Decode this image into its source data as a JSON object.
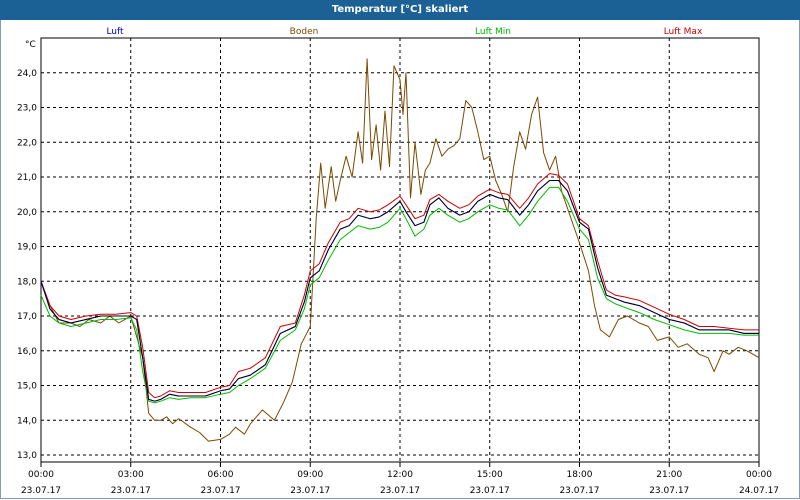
{
  "window": {
    "title": "Temperatur [°C] skaliert"
  },
  "chart_data": {
    "type": "line",
    "title": "Temperatur [°C] skaliert",
    "ylabel": "°C",
    "xlabel": "",
    "ylim": [
      12.8,
      25.0
    ],
    "xlim": [
      0,
      24
    ],
    "grid": true,
    "legend_position": "top",
    "yticks": [
      "13,0",
      "14,0",
      "15,0",
      "16,0",
      "17,0",
      "18,0",
      "19,0",
      "20,0",
      "21,0",
      "22,0",
      "23,0",
      "24,0"
    ],
    "xticks": [
      {
        "time": "00:00",
        "date": "23.07.17"
      },
      {
        "time": "03:00",
        "date": "23.07.17"
      },
      {
        "time": "06:00",
        "date": "23.07.17"
      },
      {
        "time": "09:00",
        "date": "23.07.17"
      },
      {
        "time": "12:00",
        "date": "23.07.17"
      },
      {
        "time": "15:00",
        "date": "23.07.17"
      },
      {
        "time": "18:00",
        "date": "23.07.17"
      },
      {
        "time": "21:00",
        "date": "23.07.17"
      },
      {
        "time": "00:00",
        "date": "24.07.17"
      }
    ],
    "series": [
      {
        "name": "Luft",
        "color": "#0000cc",
        "points": [
          [
            0,
            18.0
          ],
          [
            0.3,
            17.2
          ],
          [
            0.6,
            16.9
          ],
          [
            1,
            16.8
          ],
          [
            1.5,
            16.9
          ],
          [
            2,
            17.0
          ],
          [
            2.5,
            17.0
          ],
          [
            3,
            17.0
          ],
          [
            3.2,
            16.9
          ],
          [
            3.4,
            15.8
          ],
          [
            3.6,
            14.6
          ],
          [
            3.8,
            14.55
          ],
          [
            4,
            14.6
          ],
          [
            4.3,
            14.75
          ],
          [
            4.6,
            14.7
          ],
          [
            5,
            14.7
          ],
          [
            5.5,
            14.7
          ],
          [
            6,
            14.85
          ],
          [
            6.3,
            14.9
          ],
          [
            6.6,
            15.2
          ],
          [
            7,
            15.3
          ],
          [
            7.5,
            15.6
          ],
          [
            8,
            16.5
          ],
          [
            8.5,
            16.7
          ],
          [
            8.8,
            17.4
          ],
          [
            9,
            18.1
          ],
          [
            9.3,
            18.3
          ],
          [
            9.6,
            18.9
          ],
          [
            10,
            19.5
          ],
          [
            10.3,
            19.6
          ],
          [
            10.6,
            19.9
          ],
          [
            11,
            19.8
          ],
          [
            11.3,
            19.85
          ],
          [
            11.6,
            20.0
          ],
          [
            12,
            20.3
          ],
          [
            12.2,
            20.0
          ],
          [
            12.5,
            19.6
          ],
          [
            12.8,
            19.7
          ],
          [
            13,
            20.2
          ],
          [
            13.3,
            20.4
          ],
          [
            13.6,
            20.1
          ],
          [
            14,
            19.9
          ],
          [
            14.3,
            20.0
          ],
          [
            14.6,
            20.3
          ],
          [
            15,
            20.5
          ],
          [
            15.3,
            20.4
          ],
          [
            15.6,
            20.35
          ],
          [
            16,
            19.9
          ],
          [
            16.3,
            20.2
          ],
          [
            16.6,
            20.6
          ],
          [
            17,
            20.9
          ],
          [
            17.3,
            20.9
          ],
          [
            17.6,
            20.6
          ],
          [
            18,
            19.7
          ],
          [
            18.3,
            19.5
          ],
          [
            18.6,
            18.4
          ],
          [
            18.9,
            17.6
          ],
          [
            19.2,
            17.5
          ],
          [
            19.5,
            17.4
          ],
          [
            20,
            17.3
          ],
          [
            20.5,
            17.1
          ],
          [
            21,
            16.9
          ],
          [
            21.5,
            16.8
          ],
          [
            22,
            16.6
          ],
          [
            22.5,
            16.6
          ],
          [
            23,
            16.6
          ],
          [
            23.5,
            16.5
          ],
          [
            24,
            16.5
          ]
        ]
      },
      {
        "name": "Boden",
        "color": "#7a4a00",
        "points": [
          [
            0,
            18.0
          ],
          [
            0.3,
            17.3
          ],
          [
            0.6,
            16.8
          ],
          [
            1,
            16.8
          ],
          [
            1.3,
            16.7
          ],
          [
            1.6,
            16.9
          ],
          [
            2,
            16.8
          ],
          [
            2.3,
            17.0
          ],
          [
            2.6,
            16.8
          ],
          [
            3,
            17.0
          ],
          [
            3.2,
            16.4
          ],
          [
            3.4,
            15.8
          ],
          [
            3.6,
            14.2
          ],
          [
            3.8,
            14.0
          ],
          [
            4,
            14.0
          ],
          [
            4.2,
            14.1
          ],
          [
            4.4,
            13.9
          ],
          [
            4.6,
            14.05
          ],
          [
            5,
            13.8
          ],
          [
            5.3,
            13.65
          ],
          [
            5.6,
            13.4
          ],
          [
            6,
            13.45
          ],
          [
            6.3,
            13.6
          ],
          [
            6.5,
            13.8
          ],
          [
            6.8,
            13.6
          ],
          [
            7,
            13.9
          ],
          [
            7.4,
            14.3
          ],
          [
            7.8,
            14.0
          ],
          [
            8.1,
            14.5
          ],
          [
            8.4,
            15.1
          ],
          [
            8.7,
            16.2
          ],
          [
            9,
            16.7
          ],
          [
            9.2,
            19.8
          ],
          [
            9.35,
            21.4
          ],
          [
            9.5,
            20.1
          ],
          [
            9.7,
            21.3
          ],
          [
            9.85,
            20.3
          ],
          [
            10,
            20.9
          ],
          [
            10.2,
            21.6
          ],
          [
            10.4,
            21.0
          ],
          [
            10.6,
            22.3
          ],
          [
            10.75,
            21.4
          ],
          [
            10.9,
            24.4
          ],
          [
            11.05,
            21.5
          ],
          [
            11.2,
            22.5
          ],
          [
            11.35,
            21.2
          ],
          [
            11.5,
            22.9
          ],
          [
            11.65,
            21.3
          ],
          [
            11.8,
            24.2
          ],
          [
            12,
            23.8
          ],
          [
            12.1,
            22.8
          ],
          [
            12.2,
            24.0
          ],
          [
            12.35,
            20.4
          ],
          [
            12.5,
            22.0
          ],
          [
            12.7,
            20.5
          ],
          [
            12.85,
            21.2
          ],
          [
            13,
            21.4
          ],
          [
            13.2,
            22.1
          ],
          [
            13.4,
            21.6
          ],
          [
            13.6,
            21.8
          ],
          [
            13.8,
            21.9
          ],
          [
            14,
            22.1
          ],
          [
            14.2,
            23.2
          ],
          [
            14.4,
            23.0
          ],
          [
            14.6,
            22.3
          ],
          [
            14.8,
            21.5
          ],
          [
            15,
            21.6
          ],
          [
            15.2,
            20.9
          ],
          [
            15.4,
            20.5
          ],
          [
            15.6,
            20.0
          ],
          [
            15.8,
            21.3
          ],
          [
            16,
            22.3
          ],
          [
            16.2,
            21.8
          ],
          [
            16.4,
            22.8
          ],
          [
            16.6,
            23.3
          ],
          [
            16.8,
            21.7
          ],
          [
            17,
            21.2
          ],
          [
            17.2,
            21.6
          ],
          [
            17.4,
            20.6
          ],
          [
            17.6,
            20.1
          ],
          [
            18,
            19.1
          ],
          [
            18.3,
            18.3
          ],
          [
            18.5,
            17.3
          ],
          [
            18.7,
            16.6
          ],
          [
            19,
            16.4
          ],
          [
            19.3,
            16.9
          ],
          [
            19.6,
            17.0
          ],
          [
            20,
            16.8
          ],
          [
            20.3,
            16.7
          ],
          [
            20.6,
            16.3
          ],
          [
            21,
            16.4
          ],
          [
            21.3,
            16.1
          ],
          [
            21.6,
            16.2
          ],
          [
            22,
            15.9
          ],
          [
            22.3,
            15.8
          ],
          [
            22.5,
            15.4
          ],
          [
            22.8,
            16.0
          ],
          [
            23,
            15.9
          ],
          [
            23.3,
            16.1
          ],
          [
            23.6,
            16.0
          ],
          [
            24,
            15.8
          ]
        ]
      },
      {
        "name": "Luft Min",
        "color": "#00bb00",
        "points": [
          [
            0,
            17.6
          ],
          [
            0.3,
            17.0
          ],
          [
            0.6,
            16.8
          ],
          [
            1,
            16.7
          ],
          [
            1.5,
            16.8
          ],
          [
            2,
            16.9
          ],
          [
            2.5,
            16.9
          ],
          [
            3,
            16.95
          ],
          [
            3.2,
            16.6
          ],
          [
            3.4,
            15.4
          ],
          [
            3.6,
            14.55
          ],
          [
            3.8,
            14.5
          ],
          [
            4,
            14.55
          ],
          [
            4.3,
            14.65
          ],
          [
            4.6,
            14.6
          ],
          [
            5,
            14.65
          ],
          [
            5.5,
            14.65
          ],
          [
            6,
            14.75
          ],
          [
            6.3,
            14.8
          ],
          [
            6.6,
            15.0
          ],
          [
            7,
            15.2
          ],
          [
            7.5,
            15.5
          ],
          [
            8,
            16.3
          ],
          [
            8.5,
            16.6
          ],
          [
            8.8,
            17.2
          ],
          [
            9,
            17.9
          ],
          [
            9.3,
            18.1
          ],
          [
            9.6,
            18.6
          ],
          [
            10,
            19.2
          ],
          [
            10.3,
            19.4
          ],
          [
            10.6,
            19.6
          ],
          [
            11,
            19.5
          ],
          [
            11.3,
            19.55
          ],
          [
            11.6,
            19.7
          ],
          [
            12,
            20.1
          ],
          [
            12.2,
            19.8
          ],
          [
            12.5,
            19.3
          ],
          [
            12.8,
            19.5
          ],
          [
            13,
            19.9
          ],
          [
            13.3,
            20.1
          ],
          [
            13.6,
            19.9
          ],
          [
            14,
            19.7
          ],
          [
            14.3,
            19.8
          ],
          [
            14.6,
            20.0
          ],
          [
            15,
            20.2
          ],
          [
            15.3,
            20.1
          ],
          [
            15.6,
            20.05
          ],
          [
            16,
            19.6
          ],
          [
            16.3,
            19.9
          ],
          [
            16.6,
            20.3
          ],
          [
            17,
            20.7
          ],
          [
            17.3,
            20.7
          ],
          [
            17.6,
            20.3
          ],
          [
            18,
            19.5
          ],
          [
            18.3,
            19.2
          ],
          [
            18.6,
            18.1
          ],
          [
            18.9,
            17.5
          ],
          [
            19.2,
            17.35
          ],
          [
            19.5,
            17.25
          ],
          [
            20,
            17.1
          ],
          [
            20.5,
            16.9
          ],
          [
            21,
            16.75
          ],
          [
            21.5,
            16.6
          ],
          [
            22,
            16.5
          ],
          [
            22.5,
            16.5
          ],
          [
            23,
            16.5
          ],
          [
            23.5,
            16.45
          ],
          [
            24,
            16.45
          ]
        ]
      },
      {
        "name": "Luft Max",
        "color": "#cc0000",
        "points": [
          [
            0,
            18.0
          ],
          [
            0.3,
            17.3
          ],
          [
            0.6,
            17.0
          ],
          [
            1,
            16.9
          ],
          [
            1.5,
            17.0
          ],
          [
            2,
            17.05
          ],
          [
            2.5,
            17.05
          ],
          [
            3,
            17.1
          ],
          [
            3.2,
            17.0
          ],
          [
            3.4,
            16.1
          ],
          [
            3.6,
            14.8
          ],
          [
            3.8,
            14.65
          ],
          [
            4,
            14.7
          ],
          [
            4.3,
            14.85
          ],
          [
            4.6,
            14.8
          ],
          [
            5,
            14.8
          ],
          [
            5.5,
            14.8
          ],
          [
            6,
            14.95
          ],
          [
            6.3,
            15.0
          ],
          [
            6.6,
            15.4
          ],
          [
            7,
            15.5
          ],
          [
            7.5,
            15.8
          ],
          [
            8,
            16.7
          ],
          [
            8.5,
            16.8
          ],
          [
            8.8,
            17.6
          ],
          [
            9,
            18.3
          ],
          [
            9.3,
            18.5
          ],
          [
            9.6,
            19.1
          ],
          [
            10,
            19.7
          ],
          [
            10.3,
            19.8
          ],
          [
            10.6,
            20.1
          ],
          [
            11,
            20.0
          ],
          [
            11.3,
            20.05
          ],
          [
            11.6,
            20.2
          ],
          [
            12,
            20.45
          ],
          [
            12.2,
            20.2
          ],
          [
            12.5,
            19.8
          ],
          [
            12.8,
            19.9
          ],
          [
            13,
            20.35
          ],
          [
            13.3,
            20.5
          ],
          [
            13.6,
            20.3
          ],
          [
            14,
            20.1
          ],
          [
            14.3,
            20.2
          ],
          [
            14.6,
            20.45
          ],
          [
            15,
            20.65
          ],
          [
            15.3,
            20.55
          ],
          [
            15.6,
            20.5
          ],
          [
            16,
            20.1
          ],
          [
            16.3,
            20.4
          ],
          [
            16.6,
            20.8
          ],
          [
            17,
            21.1
          ],
          [
            17.3,
            21.05
          ],
          [
            17.6,
            20.8
          ],
          [
            18,
            19.8
          ],
          [
            18.3,
            19.6
          ],
          [
            18.6,
            18.6
          ],
          [
            18.9,
            17.75
          ],
          [
            19.2,
            17.6
          ],
          [
            19.5,
            17.55
          ],
          [
            20,
            17.45
          ],
          [
            20.5,
            17.25
          ],
          [
            21,
            17.05
          ],
          [
            21.5,
            16.9
          ],
          [
            22,
            16.7
          ],
          [
            22.5,
            16.7
          ],
          [
            23,
            16.65
          ],
          [
            23.5,
            16.6
          ],
          [
            24,
            16.6
          ]
        ]
      }
    ]
  }
}
